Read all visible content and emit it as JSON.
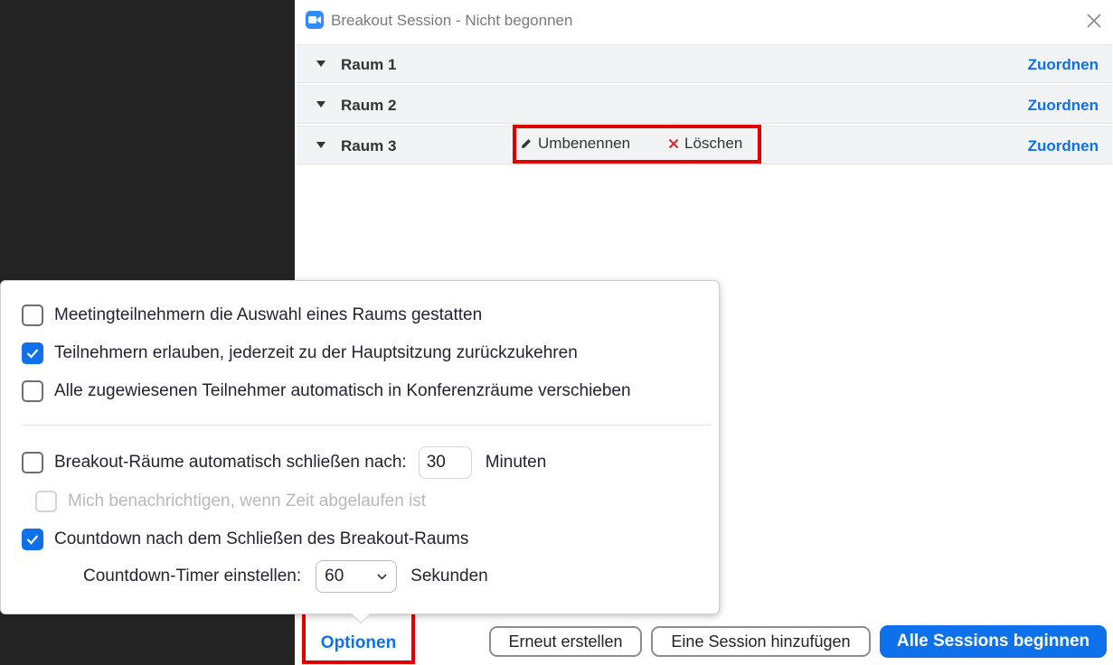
{
  "window": {
    "title": "Breakout Session - Nicht begonnen"
  },
  "rooms": [
    {
      "name": "Raum 1",
      "assign_label": "Zuordnen"
    },
    {
      "name": "Raum 2",
      "assign_label": "Zuordnen"
    },
    {
      "name": "Raum 3",
      "assign_label": "Zuordnen",
      "rename_label": "Umbenennen",
      "delete_label": "Löschen"
    }
  ],
  "footer": {
    "options_label": "Optionen",
    "recreate_label": "Erneut erstellen",
    "add_session_label": "Eine Session hinzufügen",
    "start_all_label": "Alle Sessions beginnen"
  },
  "options": {
    "allow_choose_room": {
      "label": "Meetingteilnehmern die Auswahl eines Raums gestatten",
      "checked": false
    },
    "allow_return": {
      "label": "Teilnehmern erlauben, jederzeit zu der Hauptsitzung zurückzukehren",
      "checked": true
    },
    "auto_move": {
      "label": "Alle zugewiesenen Teilnehmer automatisch in Konferenzräume verschieben",
      "checked": false
    },
    "auto_close": {
      "label": "Breakout-Räume automatisch schließen nach:",
      "checked": false,
      "value": "30",
      "unit": "Minuten"
    },
    "notify": {
      "label": "Mich benachrichtigen, wenn Zeit abgelaufen ist",
      "checked": false,
      "disabled": true
    },
    "countdown": {
      "label": "Countdown nach dem Schließen des Breakout-Raums",
      "checked": true
    },
    "countdown_timer": {
      "label": "Countdown-Timer einstellen:",
      "value": "60",
      "unit": "Sekunden"
    }
  },
  "colors": {
    "accent": "#0e71eb",
    "highlight": "#e10000",
    "background": "#242424"
  }
}
